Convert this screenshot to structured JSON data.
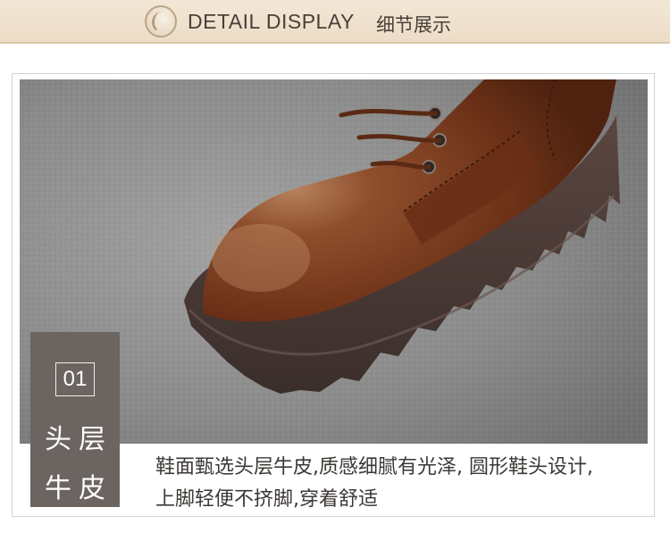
{
  "header": {
    "title_en": "DETAIL DISPLAY",
    "title_cn": "细节展示"
  },
  "detail": {
    "number": "01",
    "label_line1": "头层",
    "label_line2": "牛皮",
    "description_line1": "鞋面甄选头层牛皮,质感细腻有光泽, 圆形鞋头设计,",
    "description_line2": "上脚轻便不挤脚,穿着舒适"
  },
  "colors": {
    "header_bg": "#ecdcc7",
    "tag_bg": "#6b6461",
    "leather": "#7a4024",
    "sole": "#4a3a36"
  }
}
